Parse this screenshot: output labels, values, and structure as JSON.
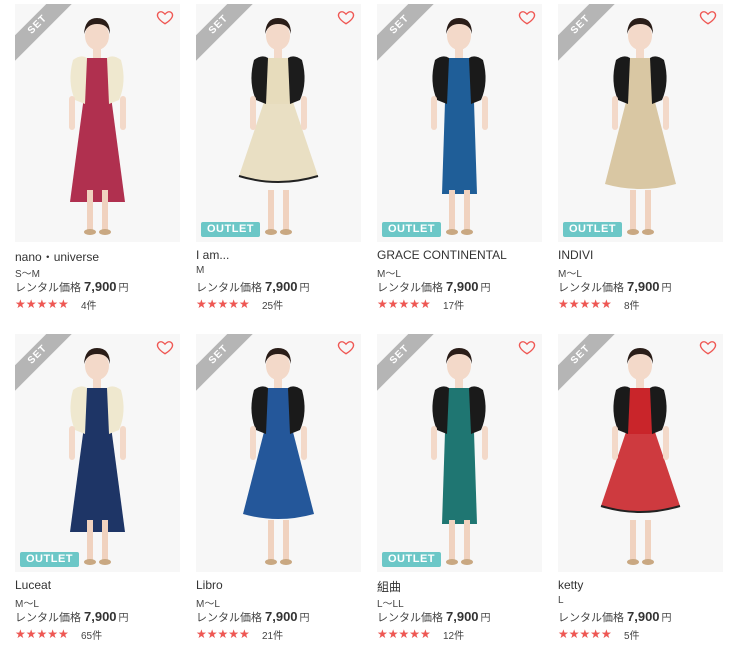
{
  "badges": {
    "set": "SET",
    "outlet": "OUTLET"
  },
  "price_label": "レンタル価格",
  "currency": "円",
  "colors": {
    "star": "#ef5753",
    "outlet": "#6cc7c7",
    "set": "#b5b5b5",
    "heart": "#ef5753"
  },
  "products": [
    {
      "brand": "nano・universe",
      "size": "S〜M",
      "price": "7,900",
      "reviews": "4件",
      "rating": 5,
      "outlet": false,
      "dress": "#b0304f",
      "jacket": "#efe8cf",
      "style": "long"
    },
    {
      "brand": "I am...",
      "size": "M",
      "price": "7,900",
      "reviews": "25件",
      "rating": 4.5,
      "outlet": true,
      "dress": "#e7dcbc",
      "jacket": "#1c1c1c",
      "style": "tulle"
    },
    {
      "brand": "GRACE CONTINENTAL",
      "size": "M〜L",
      "price": "7,900",
      "reviews": "17件",
      "rating": 4.5,
      "outlet": true,
      "dress": "#1f5e98",
      "jacket": "#1a1a1a",
      "style": "pencil"
    },
    {
      "brand": "INDIVI",
      "size": "M〜L",
      "price": "7,900",
      "reviews": "8件",
      "rating": 5,
      "outlet": true,
      "dress": "#d9c7a3",
      "jacket": "#1a1a1a",
      "style": "flare"
    },
    {
      "brand": "Luceat",
      "size": "M〜L",
      "price": "7,900",
      "reviews": "65件",
      "rating": 4.5,
      "outlet": true,
      "dress": "#1e3566",
      "jacket": "#efe8cf",
      "style": "long"
    },
    {
      "brand": "Libro",
      "size": "M〜L",
      "price": "7,900",
      "reviews": "21件",
      "rating": 4.5,
      "outlet": false,
      "dress": "#24579a",
      "jacket": "#1a1a1a",
      "style": "flare"
    },
    {
      "brand": "組曲",
      "size": "L〜LL",
      "price": "7,900",
      "reviews": "12件",
      "rating": 5,
      "outlet": true,
      "dress": "#1f7672",
      "jacket": "#1a1a1a",
      "style": "pencil"
    },
    {
      "brand": "ketty",
      "size": "L",
      "price": "7,900",
      "reviews": "5件",
      "rating": 4.5,
      "outlet": false,
      "dress": "#c9252a",
      "jacket": "#1a1a1a",
      "style": "tulle"
    }
  ]
}
